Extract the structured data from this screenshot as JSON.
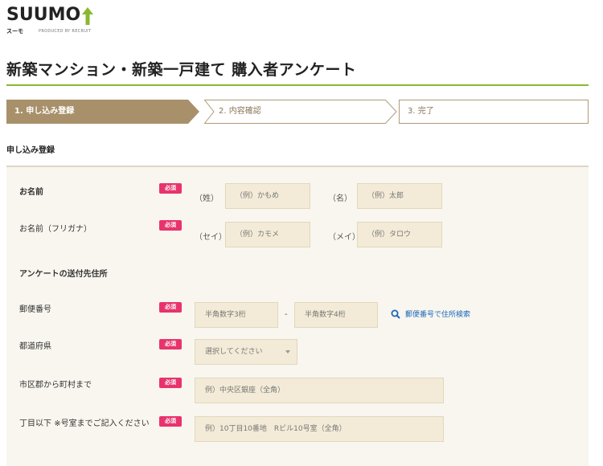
{
  "logo": {
    "word": "SUUMO",
    "sub": "スーモ",
    "produced": "PRODUCED BY RECRUIT"
  },
  "page_title": "新築マンション・新築一戸建て 購入者アンケート",
  "steps": [
    "1. 申し込み登録",
    "2. 内容確認",
    "3. 完了"
  ],
  "section_label": "申し込み登録",
  "required_badge": "必須",
  "form": {
    "name": {
      "label": "お名前",
      "sei_prefix": "（姓）",
      "sei_placeholder": "（例）かもめ",
      "mei_prefix": "（名）",
      "mei_placeholder": "（例）太郎"
    },
    "furigana": {
      "label": "お名前（フリガナ）",
      "sei_prefix": "（セイ）",
      "sei_placeholder": "（例）カモメ",
      "mei_prefix": "（メイ）",
      "mei_placeholder": "（例）タロウ"
    },
    "address_heading": "アンケートの送付先住所",
    "postal": {
      "label": "郵便番号",
      "first_placeholder": "半角数字3桁",
      "separator": "-",
      "second_placeholder": "半角数字4桁",
      "search_link": "郵便番号で住所検索"
    },
    "prefecture": {
      "label": "都道府県",
      "selected": "選択してください"
    },
    "city": {
      "label": "市区郡から町村まで",
      "placeholder": "例）中央区銀座（全角）"
    },
    "street": {
      "label": "丁目以下",
      "note": "※号室までご記入ください",
      "placeholder": "例）10丁目10番地　Rビル10号室（全角）"
    }
  },
  "colors": {
    "brand_green": "#8ab832",
    "step_active": "#a8906a",
    "required": "#e8336d",
    "field_bg": "#f3ebd7",
    "link": "#1a66b8"
  }
}
